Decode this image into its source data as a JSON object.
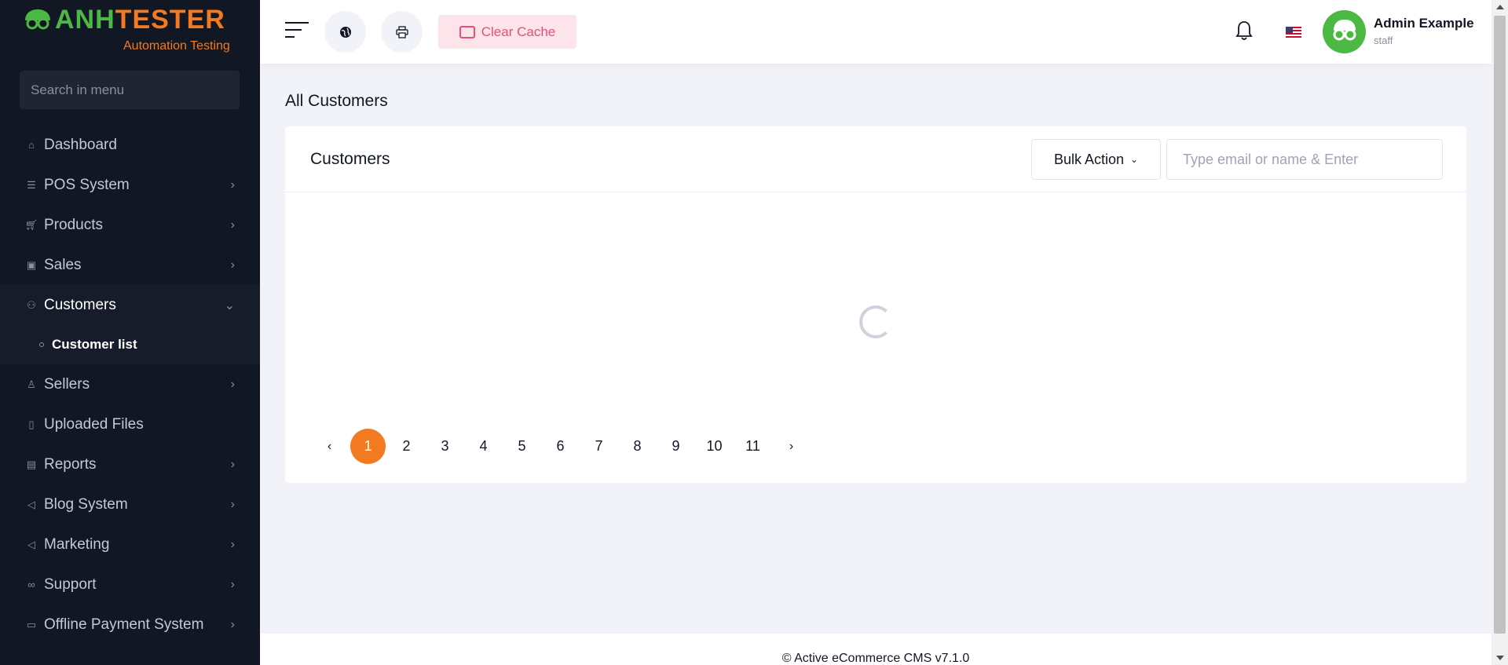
{
  "brand": {
    "logo_text_first": "ANH",
    "logo_text_rest": "TESTER",
    "logo_sub": "Automation Testing",
    "primary_color": "#f37a20",
    "secondary_color": "#4cb944"
  },
  "sidebar": {
    "search_placeholder": "Search in menu",
    "items": [
      {
        "label": "Dashboard",
        "icon": "home-icon",
        "chevron": ""
      },
      {
        "label": "POS System",
        "icon": "list-icon",
        "chevron": "›"
      },
      {
        "label": "Products",
        "icon": "cart-icon",
        "chevron": "›"
      },
      {
        "label": "Sales",
        "icon": "money-icon",
        "chevron": "›"
      },
      {
        "label": "Customers",
        "icon": "users-icon",
        "chevron": "⌄"
      },
      {
        "label": "Sellers",
        "icon": "user-icon",
        "chevron": "›"
      },
      {
        "label": "Uploaded Files",
        "icon": "folder-icon",
        "chevron": ""
      },
      {
        "label": "Reports",
        "icon": "file-icon",
        "chevron": "›"
      },
      {
        "label": "Blog System",
        "icon": "megaphone-icon",
        "chevron": "›"
      },
      {
        "label": "Marketing",
        "icon": "megaphone-icon",
        "chevron": "›"
      },
      {
        "label": "Support",
        "icon": "link-icon",
        "chevron": "›"
      },
      {
        "label": "Offline Payment System",
        "icon": "cash-icon",
        "chevron": "›"
      }
    ],
    "submenu_customers": {
      "label": "Customer list"
    }
  },
  "topbar": {
    "clear_cache_label": "Clear Cache",
    "user_name": "Admin Example",
    "user_role": "staff"
  },
  "main": {
    "page_title": "All Customers",
    "card_title": "Customers",
    "bulk_action_label": "Bulk Action",
    "search_placeholder": "Type email or name & Enter",
    "pagination": {
      "prev": "‹",
      "next": "›",
      "pages": [
        "1",
        "2",
        "3",
        "4",
        "5",
        "6",
        "7",
        "8",
        "9",
        "10",
        "11"
      ],
      "current": "1"
    }
  },
  "footer": {
    "text": "© Active eCommerce CMS v7.1.0"
  }
}
